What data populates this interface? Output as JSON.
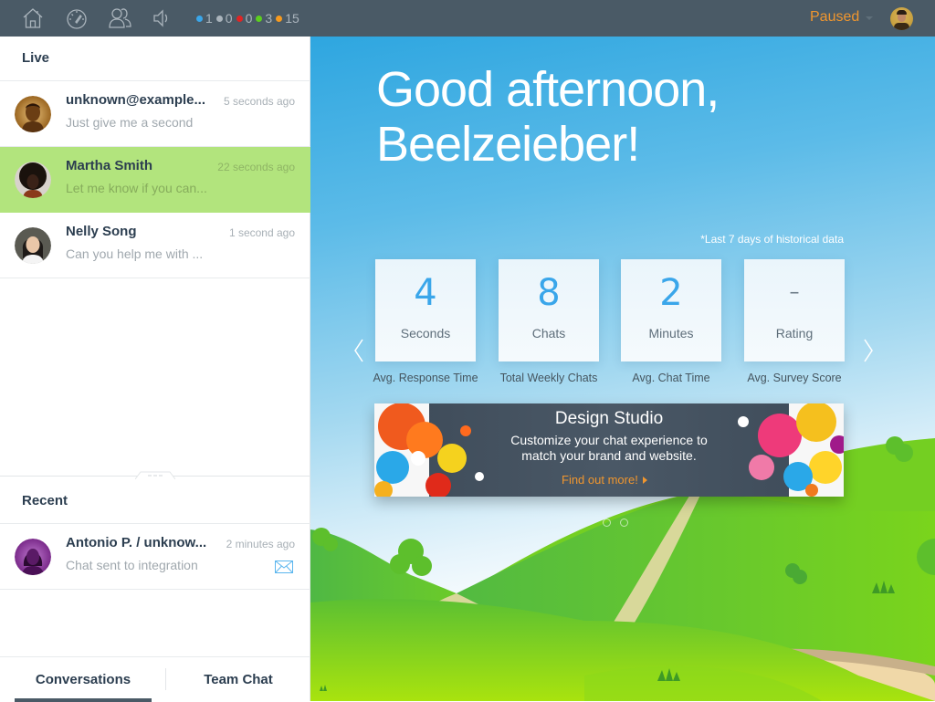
{
  "topbar": {
    "nav": [
      {
        "name": "home",
        "icon": "home-icon"
      },
      {
        "name": "dashboard",
        "icon": "speedometer-icon"
      },
      {
        "name": "visitors",
        "icon": "users-icon"
      },
      {
        "name": "sound",
        "icon": "speaker-icon"
      }
    ],
    "counters": [
      {
        "color": "#3aa6ea",
        "value": "1"
      },
      {
        "color": "#aab4bc",
        "value": "0"
      },
      {
        "color": "#e02424",
        "value": "0"
      },
      {
        "color": "#5ccf1e",
        "value": "3"
      },
      {
        "color": "#f79a1e",
        "value": "15"
      }
    ],
    "status": "Paused",
    "avatar": "user-avatar"
  },
  "sidebar": {
    "live_title": "Live",
    "live_chats": [
      {
        "name": "unknown@example...",
        "time": "5 seconds ago",
        "preview": "Just give me a second",
        "active": false,
        "avatar": "default-male"
      },
      {
        "name": "Martha Smith",
        "time": "22 seconds ago",
        "preview": "Let me know if you can...",
        "active": true,
        "avatar": "martha"
      },
      {
        "name": "Nelly Song",
        "time": "1 second ago",
        "preview": "Can you help me with ...",
        "active": false,
        "avatar": "nelly"
      }
    ],
    "recent_title": "Recent",
    "recent_chats": [
      {
        "name": "Antonio P. / unknow...",
        "time": "2 minutes ago",
        "preview": "Chat sent to integration",
        "icon": "mail-icon",
        "avatar": "default-female"
      }
    ],
    "tabs": [
      {
        "label": "Conversations",
        "active": true
      },
      {
        "label": "Team Chat",
        "active": false
      }
    ]
  },
  "main": {
    "greeting_line1": "Good afternoon,",
    "greeting_line2": "Beelzeieber!",
    "historical_note": "*Last 7 days of historical data",
    "stats": [
      {
        "value": "4",
        "unit": "Seconds",
        "label": "Avg. Response Time"
      },
      {
        "value": "8",
        "unit": "Chats",
        "label": "Total Weekly Chats"
      },
      {
        "value": "2",
        "unit": "Minutes",
        "label": "Avg. Chat Time"
      },
      {
        "value": "–",
        "unit": "Rating",
        "label": "Avg. Survey Score"
      }
    ],
    "banner": {
      "title": "Design Studio",
      "subtitle_line1": "Customize your chat experience to",
      "subtitle_line2": "match your brand and website.",
      "cta": "Find out more!"
    },
    "carousel_pages": 2
  }
}
